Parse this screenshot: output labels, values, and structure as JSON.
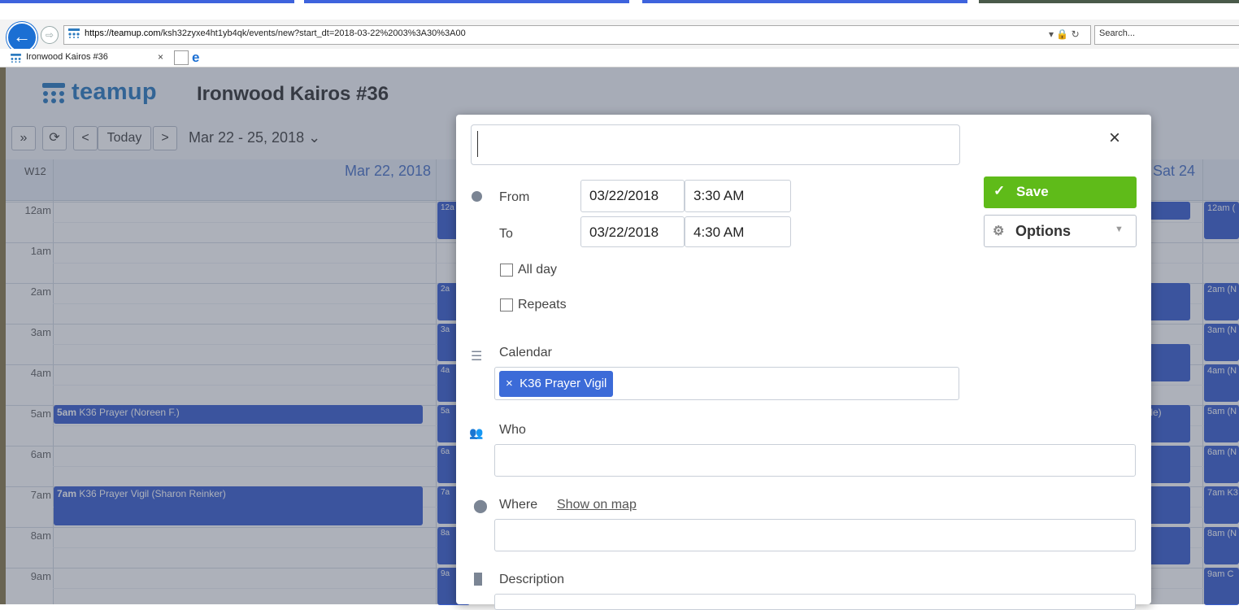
{
  "browser": {
    "url_prefix": "https://teamup.com",
    "url_rest": "/ksh32zyxe4ht1yb4qk/events/new?start_dt=2018-03-22%2003%3A30%3A00",
    "search_placeholder": "Search...",
    "tab_title": "Ironwood Kairos #36",
    "tab_close": "×"
  },
  "app": {
    "brand": "teamup",
    "calendar_title": "Ironwood Kairos #36"
  },
  "toolbar": {
    "expand": "»",
    "refresh": "⟳",
    "prev": "<",
    "today": "Today",
    "next": ">",
    "range": "Mar 22 - 25, 2018"
  },
  "grid": {
    "week_label": "W12",
    "day1_label": "Mar 22, 2018",
    "day3_label": "Sat 24",
    "hours": [
      "12am",
      "1am",
      "2am",
      "3am",
      "4am",
      "5am",
      "6am",
      "7am",
      "8am",
      "9am"
    ],
    "col2_labels": [
      "12a",
      "2a",
      "3a",
      "4a",
      "5a",
      "6a",
      "7a",
      "8a",
      "9a"
    ],
    "col4_labels": [
      "12am (",
      "2am (N",
      "3am (N",
      "4am (N",
      "5am (N",
      "6am (N",
      "7am K3",
      "8am (N",
      "9am C"
    ],
    "col3_fragment": "tle)",
    "events": [
      {
        "time": "5am",
        "title": "K36 Prayer (Noreen F.)"
      },
      {
        "time": "7am",
        "title": "K36 Prayer Vigil (Sharon Reinker)"
      }
    ]
  },
  "modal": {
    "title_value": "",
    "close": "×",
    "from_label": "From",
    "from_date": "03/22/2018",
    "from_time": "3:30 AM",
    "to_label": "To",
    "to_date": "03/22/2018",
    "to_time": "4:30 AM",
    "all_day_label": "All day",
    "repeats_label": "Repeats",
    "save_label": "Save",
    "options_label": "Options",
    "calendar_label": "Calendar",
    "calendar_tag": "K36 Prayer Vigil",
    "calendar_tag_remove": "×",
    "who_label": "Who",
    "where_label": "Where",
    "show_on_map": "Show on map",
    "description_label": "Description"
  },
  "colors": {
    "brand": "#2c7bbf",
    "event": "#3b5fcf",
    "save": "#5fbb19",
    "tag": "#3c6bd8"
  }
}
